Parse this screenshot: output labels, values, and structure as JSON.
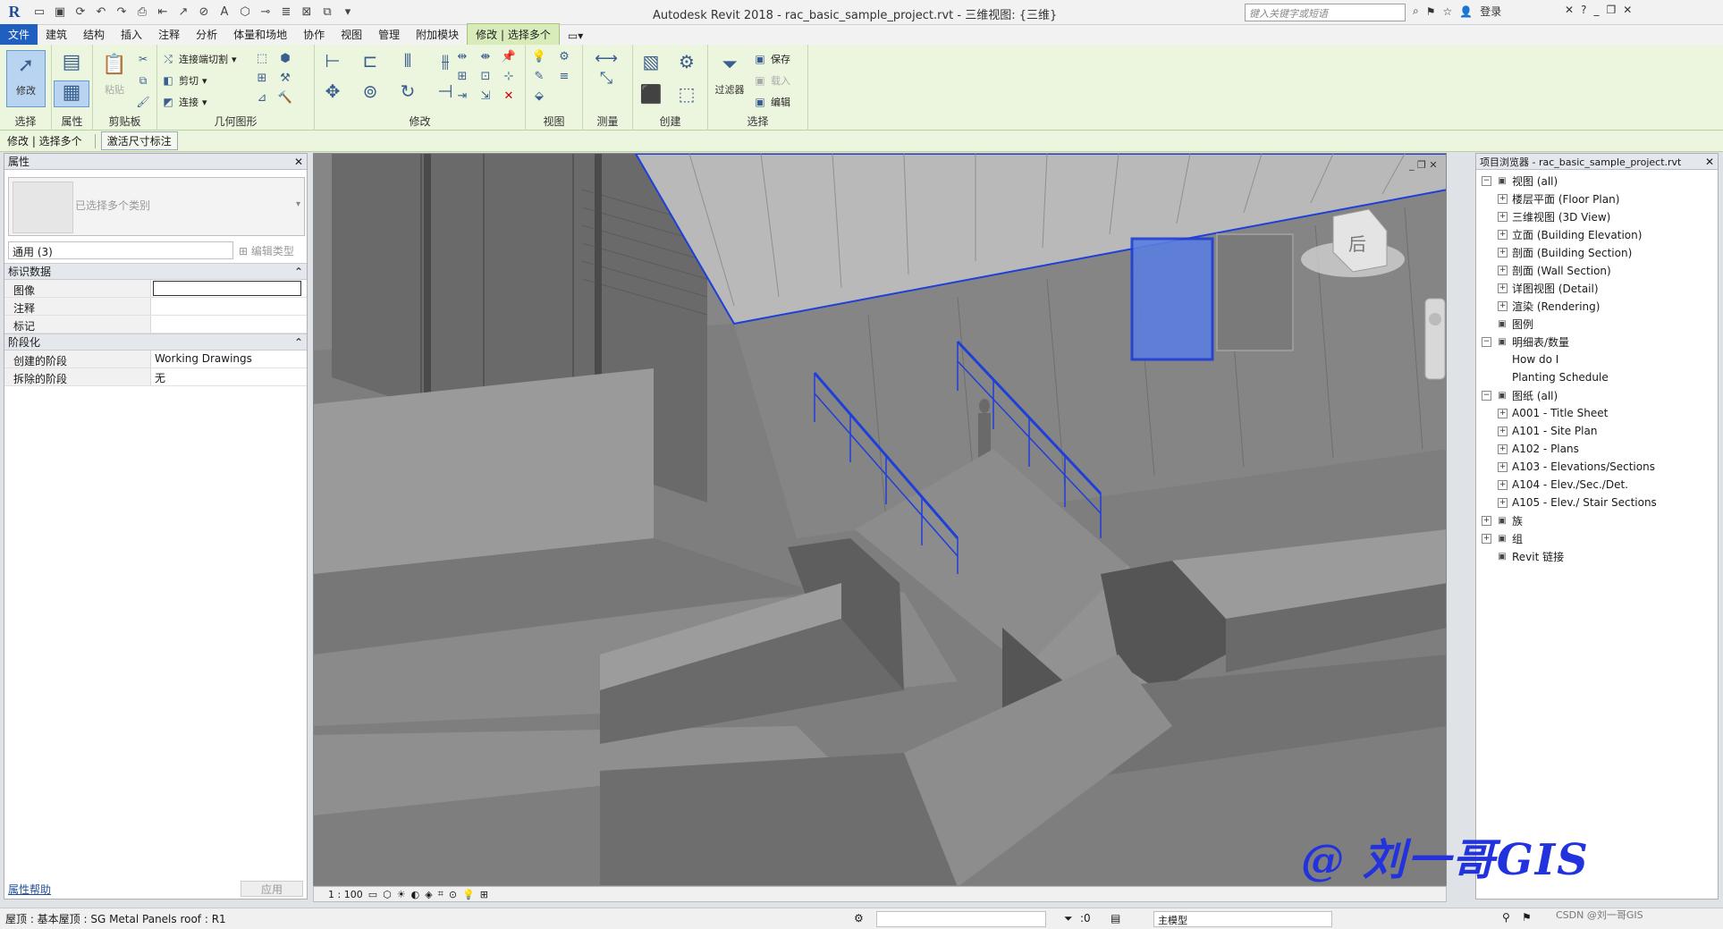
{
  "app": {
    "title": "Autodesk Revit 2018  -  rac_basic_sample_project.rvt - 三维视图: {三维}",
    "search_placeholder": "键入关键字或短语",
    "login_label": "登录"
  },
  "tabs": [
    "文件",
    "建筑",
    "结构",
    "插入",
    "注释",
    "分析",
    "体量和场地",
    "协作",
    "视图",
    "管理",
    "附加模块",
    "修改 | 选择多个"
  ],
  "ribbon": {
    "select": {
      "modify_label": "修改",
      "panel": "选择"
    },
    "properties": {
      "panel": "属性"
    },
    "clipboard": {
      "paste_label": "粘贴",
      "panel": "剪贴板"
    },
    "geometry": {
      "join_cut_label": "连接端切割",
      "cut_label": "剪切",
      "join_label": "连接",
      "panel": "几何图形"
    },
    "modify": {
      "panel": "修改"
    },
    "view": {
      "panel": "视图"
    },
    "measure": {
      "panel": "测量"
    },
    "create": {
      "panel": "创建"
    },
    "filter": {
      "filter_label": "过滤器",
      "panel": "选择",
      "save_label": "保存",
      "load_label": "载入",
      "edit_label": "编辑"
    }
  },
  "optbar": {
    "context": "修改 | 选择多个",
    "activate_dim": "激活尺寸标注"
  },
  "properties": {
    "title": "属性",
    "type_name": "已选择多个类别",
    "filter_value": "通用 (3)",
    "edit_type": "编辑类型",
    "groups": [
      {
        "name": "标识数据",
        "rows": [
          {
            "k": "图像",
            "v": ""
          },
          {
            "k": "注释",
            "v": ""
          },
          {
            "k": "标记",
            "v": ""
          }
        ]
      },
      {
        "name": "阶段化",
        "rows": [
          {
            "k": "创建的阶段",
            "v": "Working Drawings"
          },
          {
            "k": "拆除的阶段",
            "v": "无"
          }
        ]
      }
    ],
    "help": "属性帮助",
    "apply": "应用"
  },
  "view": {
    "scale": "1 : 100",
    "viewcube_label": "后"
  },
  "browser": {
    "title": "项目浏览器 - rac_basic_sample_project.rvt",
    "items": [
      {
        "label": "视图 (all)",
        "level": 0,
        "toggle": "−"
      },
      {
        "label": "楼层平面 (Floor Plan)",
        "level": 1,
        "toggle": "+"
      },
      {
        "label": "三维视图 (3D View)",
        "level": 1,
        "toggle": "+"
      },
      {
        "label": "立面 (Building Elevation)",
        "level": 1,
        "toggle": "+"
      },
      {
        "label": "剖面 (Building Section)",
        "level": 1,
        "toggle": "+"
      },
      {
        "label": "剖面 (Wall Section)",
        "level": 1,
        "toggle": "+"
      },
      {
        "label": "详图视图 (Detail)",
        "level": 1,
        "toggle": "+"
      },
      {
        "label": "渲染 (Rendering)",
        "level": 1,
        "toggle": "+"
      },
      {
        "label": "图例",
        "level": 0,
        "toggle": ""
      },
      {
        "label": "明细表/数量",
        "level": 0,
        "toggle": "−"
      },
      {
        "label": "How do I",
        "level": 1,
        "toggle": ""
      },
      {
        "label": "Planting Schedule",
        "level": 1,
        "toggle": ""
      },
      {
        "label": "图纸 (all)",
        "level": 0,
        "toggle": "−"
      },
      {
        "label": "A001 - Title Sheet",
        "level": 1,
        "toggle": "+"
      },
      {
        "label": "A101 - Site Plan",
        "level": 1,
        "toggle": "+"
      },
      {
        "label": "A102 - Plans",
        "level": 1,
        "toggle": "+"
      },
      {
        "label": "A103 - Elevations/Sections",
        "level": 1,
        "toggle": "+"
      },
      {
        "label": "A104 - Elev./Sec./Det.",
        "level": 1,
        "toggle": "+"
      },
      {
        "label": "A105 - Elev./ Stair Sections",
        "level": 1,
        "toggle": "+"
      },
      {
        "label": "族",
        "level": 0,
        "toggle": "+"
      },
      {
        "label": "组",
        "level": 0,
        "toggle": "+"
      },
      {
        "label": "Revit 链接",
        "level": 0,
        "toggle": ""
      }
    ]
  },
  "status": {
    "text": "屋顶 : 基本屋顶 : SG Metal Panels roof : R1",
    "count": ":0",
    "model": "主模型"
  },
  "watermark": "@ 刘一哥GIS",
  "csdn": "CSDN @刘一哥GIS"
}
